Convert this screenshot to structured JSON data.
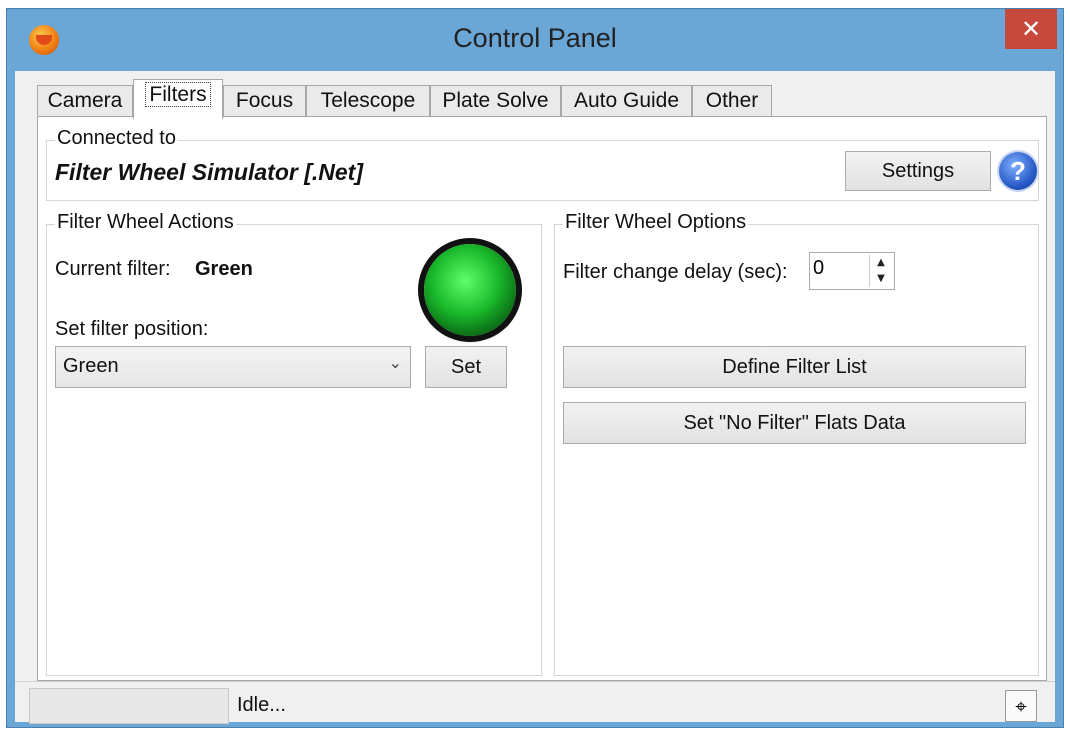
{
  "window": {
    "title": "Control Panel",
    "close_label": "✕"
  },
  "tabs": [
    {
      "label": "Camera"
    },
    {
      "label": "Filters"
    },
    {
      "label": "Focus"
    },
    {
      "label": "Telescope"
    },
    {
      "label": "Plate Solve"
    },
    {
      "label": "Auto Guide"
    },
    {
      "label": "Other"
    }
  ],
  "active_tab": "Filters",
  "connected": {
    "group_title": "Connected to",
    "device": "Filter Wheel Simulator [.Net]",
    "settings_label": "Settings",
    "help_label": "?"
  },
  "actions": {
    "group_title": "Filter Wheel Actions",
    "current_filter_label": "Current filter:",
    "current_filter_value": "Green",
    "set_position_label": "Set filter position:",
    "filter_select_value": "Green",
    "set_label": "Set",
    "indicator_color": "#19b82a"
  },
  "options": {
    "group_title": "Filter Wheel Options",
    "delay_label": "Filter change delay (sec):",
    "delay_value": "0",
    "define_filter_list_label": "Define Filter List",
    "no_filter_flats_label": "Set \"No Filter\" Flats Data"
  },
  "status": {
    "text": "Idle..."
  }
}
